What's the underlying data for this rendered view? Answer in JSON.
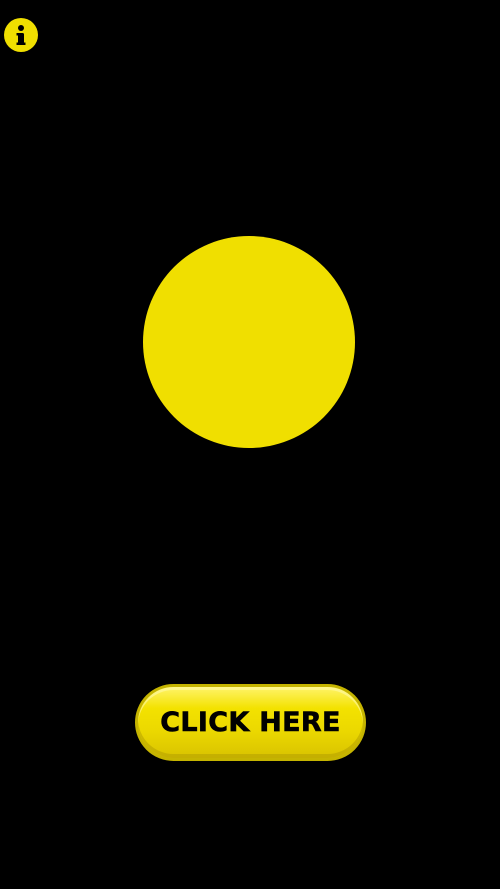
{
  "info_button": {
    "icon": "info-icon"
  },
  "main": {
    "click_button_label": "CLICK HERE"
  },
  "colors": {
    "background": "#000000",
    "accent_yellow": "#f0df00",
    "text": "#000000"
  }
}
